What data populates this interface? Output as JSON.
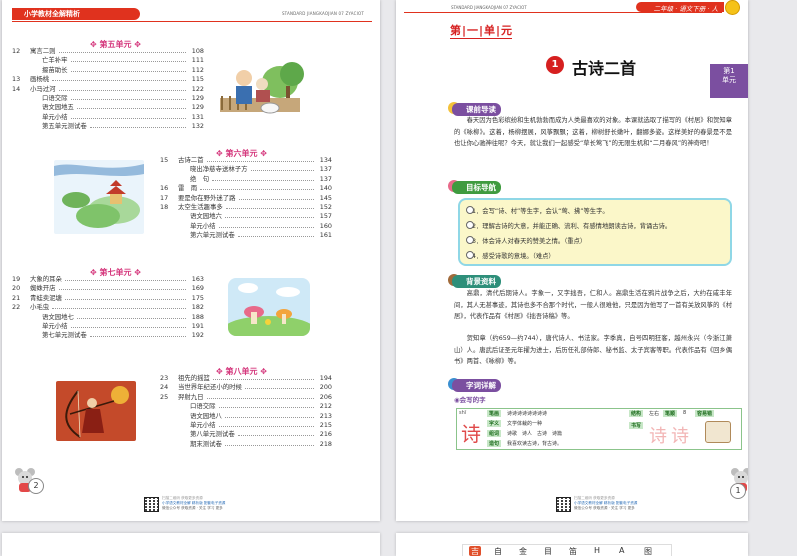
{
  "left_page": {
    "header_title": "小学教材全解精析",
    "header_code": "STANDARD JIANGKAOJIAN 07 ZYACIOT",
    "units": [
      {
        "title": "第五单元",
        "items": [
          {
            "num": "12",
            "title": "寓言二则",
            "page": "108"
          },
          {
            "num": "",
            "title": "亡羊补牢",
            "page": "111"
          },
          {
            "num": "",
            "title": "揠苗助长",
            "page": "112"
          },
          {
            "num": "13",
            "title": "画杨桃",
            "page": "115"
          },
          {
            "num": "14",
            "title": "小马过河",
            "page": "122"
          },
          {
            "num": "",
            "title": "口语交际",
            "page": "129"
          },
          {
            "num": "",
            "title": "语文园地五",
            "page": "129"
          },
          {
            "num": "",
            "title": "单元小结",
            "page": "131"
          },
          {
            "num": "",
            "title": "第五单元测试卷",
            "page": "132"
          }
        ]
      },
      {
        "title": "第六单元",
        "items": [
          {
            "num": "15",
            "title": "古诗二首",
            "page": "134"
          },
          {
            "num": "",
            "title": "晓出净慈寺送林子方",
            "page": "137"
          },
          {
            "num": "",
            "title": "绝　句",
            "page": "137"
          },
          {
            "num": "16",
            "title": "雷　雨",
            "page": "140"
          },
          {
            "num": "17",
            "title": "要是你在野外迷了路",
            "page": "145"
          },
          {
            "num": "18",
            "title": "太空生活趣事多",
            "page": "152"
          },
          {
            "num": "",
            "title": "语文园地六",
            "page": "157"
          },
          {
            "num": "",
            "title": "单元小结",
            "page": "160"
          },
          {
            "num": "",
            "title": "第六单元测试卷",
            "page": "161"
          }
        ]
      },
      {
        "title": "第七单元",
        "items": [
          {
            "num": "19",
            "title": "大象的耳朵",
            "page": "163"
          },
          {
            "num": "20",
            "title": "蜘蛛开店",
            "page": "169"
          },
          {
            "num": "21",
            "title": "青蛙卖泥塘",
            "page": "175"
          },
          {
            "num": "22",
            "title": "小毛虫",
            "page": "182"
          },
          {
            "num": "",
            "title": "语文园地七",
            "page": "188"
          },
          {
            "num": "",
            "title": "单元小结",
            "page": "191"
          },
          {
            "num": "",
            "title": "第七单元测试卷",
            "page": "192"
          }
        ]
      },
      {
        "title": "第八单元",
        "items": [
          {
            "num": "23",
            "title": "祖先的摇篮",
            "page": "194"
          },
          {
            "num": "24",
            "title": "当世界年纪还小的时候",
            "page": "200"
          },
          {
            "num": "25",
            "title": "羿射九日",
            "page": "206"
          },
          {
            "num": "",
            "title": "口语交际",
            "page": "212"
          },
          {
            "num": "",
            "title": "语文园地八",
            "page": "213"
          },
          {
            "num": "",
            "title": "单元小结",
            "page": "215"
          },
          {
            "num": "",
            "title": "第八单元测试卷",
            "page": "216"
          },
          {
            "num": "",
            "title": "期末测试卷",
            "page": "218"
          }
        ]
      }
    ],
    "page_number": "2",
    "footer_lines": [
      "扫描二维码 获取更多资源",
      "小学语文教材全解 精析版 配套电子资源",
      "微信公众号 获取资源 · 关注 学习 更多"
    ]
  },
  "right_page": {
    "header_code": "STANDARD JIANGKAOJIAN 07 ZYACIOT",
    "header_band": "二年级 · 语文下册 · 人",
    "unit_heading": "第|一|单|元",
    "side_tab": "第1\n单元",
    "lesson_number": "1",
    "lesson_title": "古诗二首",
    "sections": {
      "intro_label": "课前导读",
      "intro_text": "春天因为色彩缤纷和生机勃勃而成为人类最喜欢的对象。本课就选取了描写的《村居》和贺知章的《咏柳》。这着，杨柳摆展，风筝飘飘；这着，柳树舒长嫩叶，翻娜多姿。这样美好的春景是不是也让你心驰神往呢？今天，就让我们一起感受“草长莺飞”的无限生机和“二月春风”的神奇吧！",
      "goals_label": "目标导航",
      "goals": [
        "1．会写“诗、村”等生字，会认“莺、拂”等生字。",
        "2．理解古诗的大意，并能正确、流利、有感情地朗读古诗，背诵古诗。",
        "3．体会诗人对春天的赞美之情。（重点）",
        "4．感受诗歌的意境。（难点）"
      ],
      "background_label": "背景资料",
      "background_text_1": "高鼎，清代后期诗人。字象一，又字拙吾，仁和人。高鼎生活在鸦片战争之后，大约在咸丰年间，其人无甚事迹，其诗也多不合那个时代，一般人很难他，只是因为他写了一首有关放风筝的《村居》，代表作品有《村居》《拙吾诗稿》等。",
      "background_text_2": "贺知章（约659—约744），唐代诗人、书法家。字季真，自号四明狂客，越州永兴（今浙江萧山）人。唐武后证圣元年擢为进士，后历任礼部侍郎、秘书监、太子宾客等职。代表作品有《回乡偶书》两首、《咏柳》等。",
      "vocab_label": "字词详解",
      "vocab_sub": "会写的字",
      "char": "诗",
      "char_pinyin": "shī",
      "table_labels": [
        "笔画",
        "字义",
        "组词",
        "造句",
        "结构",
        "笔顺",
        "容易错",
        "书写"
      ],
      "table_values": [
        "诗诗诗诗诗诗诗诗",
        "文学体裁的一种",
        "诗歌　诗人　古诗　诗篇",
        "我喜欢读古诗，背古诗。",
        "左右",
        "8"
      ]
    },
    "page_number": "1",
    "footer_lines": [
      "扫描二维码 获取更多资源",
      "小学语文教材全解 精析版 配套电子资源",
      "微信公众号 获取资源 · 关注 学习 更多"
    ]
  },
  "colors": {
    "brand_red": "#e0321e",
    "unit_pink": "#d4347a",
    "purple": "#7b4fa0",
    "goals_border": "#8fd7e6",
    "goals_bg": "#fbf7c9"
  },
  "toolbar": {
    "items": [
      "吉",
      "自",
      "金",
      "目",
      "笛",
      "H",
      "A",
      "图"
    ]
  }
}
